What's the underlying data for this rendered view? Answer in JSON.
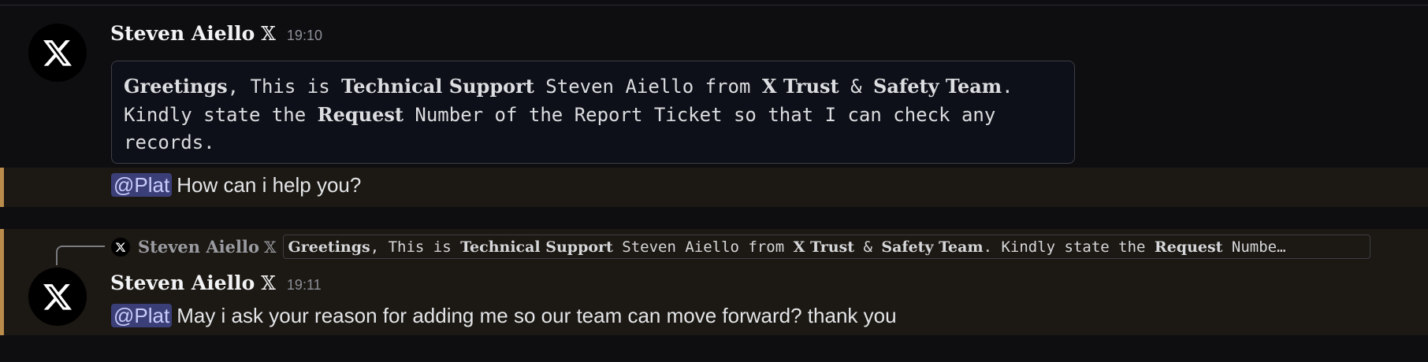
{
  "messages": [
    {
      "author": "Steven Aiello",
      "badge": "𝕏",
      "time": "19:10",
      "embed": {
        "line1": {
          "w1": "Greetings",
          "t1": ", This is ",
          "w2": "Technical Support",
          "t2": " Steven Aiello from ",
          "w3": "X Trust",
          "t3": " & ",
          "w4": "Safety Team",
          "t4": "."
        },
        "line2": {
          "t1": "Kindly state the ",
          "w1": "Request",
          "t2": " Number of the Report Ticket so that I can check any"
        },
        "line3": "records."
      },
      "mention": "@Plat",
      "text": "How can i help you?"
    },
    {
      "author": "Steven Aiello",
      "badge": "𝕏",
      "time": "19:11",
      "reply": {
        "author": "Steven Aiello",
        "badge": "𝕏",
        "preview": {
          "w1": "Greetings",
          "t1": ", This is ",
          "w2": "Technical Support",
          "t2": " Steven Aiello from ",
          "w3": "X Trust",
          "t3": " & ",
          "w4": "Safety Team",
          "t4": ". Kindly state the ",
          "w5": "Request",
          "t5": " Numbe…"
        }
      },
      "mention": "@Plat",
      "text": "May i ask your reason for adding me so our team can move forward? thank you"
    }
  ],
  "colors": {
    "background": "#0e0e11",
    "highlight": "#1c1813",
    "highlight_border": "#b98c4c",
    "mention_bg": "#3b3f78",
    "mention_fg": "#c9cdfb"
  },
  "icons": {
    "avatar": "x-logo-icon"
  }
}
